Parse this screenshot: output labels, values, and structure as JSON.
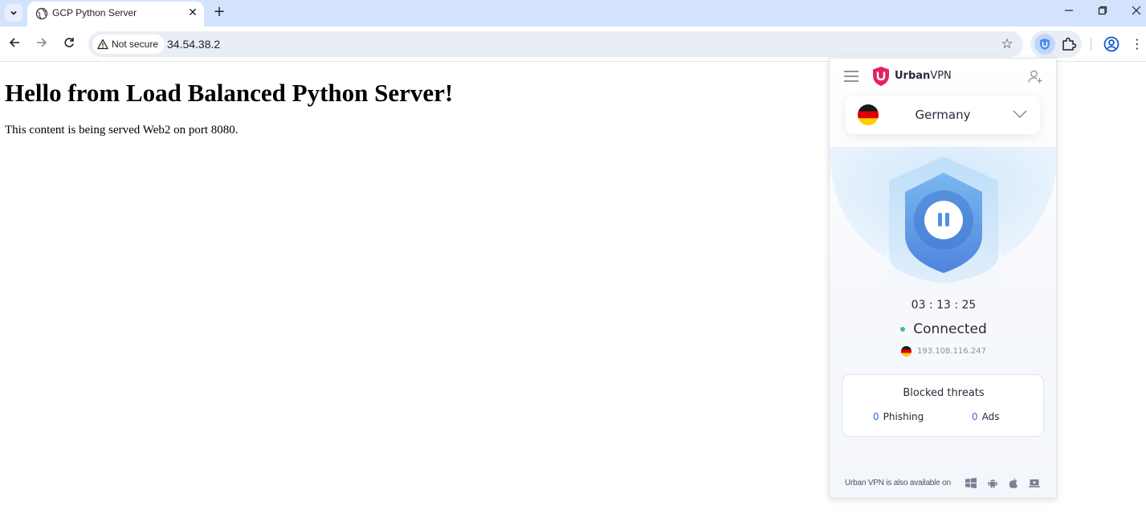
{
  "browser": {
    "tab": {
      "title": "GCP Python Server"
    },
    "address_bar": {
      "security_label": "Not secure",
      "url": "34.54.38.2"
    }
  },
  "page": {
    "heading": "Hello from Load Balanced Python Server!",
    "body_text": "This content is being served Web2 on port 8080."
  },
  "vpn_popup": {
    "brand_bold": "Urban",
    "brand_rest": "VPN",
    "country": "Germany",
    "timer": "03 : 13 : 25",
    "status": "Connected",
    "ip": "193.108.116.247",
    "blocked_threats": {
      "title": "Blocked threats",
      "phishing_count": "0",
      "phishing_label": "Phishing",
      "ads_count": "0",
      "ads_label": "Ads"
    },
    "footer": "Urban VPN is also available on",
    "platforms": [
      "windows-icon",
      "android-icon",
      "apple-icon",
      "laptop-icon"
    ]
  },
  "colors": {
    "tabstrip_bg": "#d3e3fd",
    "omnibox_bg": "#e9eef6",
    "vpn_shield_blue": "#4f8fe6",
    "vpn_status_green": "#3ec28f",
    "threat_count_blue": "#3a6fd8",
    "urbanvpn_brand_pink": "#e0245e"
  }
}
